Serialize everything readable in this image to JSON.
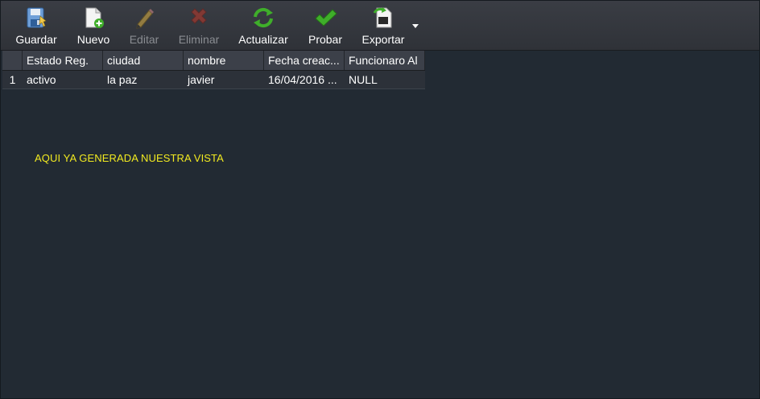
{
  "toolbar": {
    "buttons": [
      {
        "label": "Guardar",
        "icon": "save-icon",
        "enabled": true
      },
      {
        "label": "Nuevo",
        "icon": "new-document-icon",
        "enabled": true
      },
      {
        "label": "Editar",
        "icon": "pencil-icon",
        "enabled": false
      },
      {
        "label": "Eliminar",
        "icon": "delete-x-icon",
        "enabled": false
      },
      {
        "label": "Actualizar",
        "icon": "refresh-icon",
        "enabled": true
      },
      {
        "label": "Probar",
        "icon": "checkmark-icon",
        "enabled": true
      },
      {
        "label": "Exportar",
        "icon": "export-icon",
        "enabled": true
      }
    ],
    "export_menu_icon": "chevron-down-icon"
  },
  "grid": {
    "columns": [
      "",
      "Estado Reg.",
      "ciudad",
      "nombre",
      "Fecha creac...",
      "Funcionaro Al"
    ],
    "rows": [
      [
        "1",
        "activo",
        "la paz",
        "javier",
        "16/04/2016 ...",
        "NULL"
      ]
    ]
  },
  "note": "AQUI YA GENERADA NUESTRA VISTA",
  "colors": {
    "background": "#222a33",
    "toolbar": "#34373d",
    "note_text": "#f2ea20",
    "green_icon": "#3fae2a",
    "red_icon": "#c0392b"
  }
}
